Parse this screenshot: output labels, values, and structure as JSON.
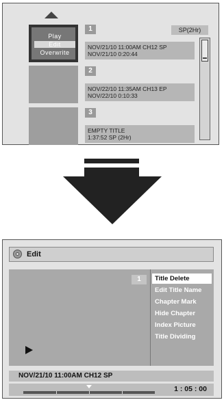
{
  "top_screen": {
    "context_menu": [
      "Play",
      "Edit",
      "Overwrite"
    ],
    "selected_menu_index": 1,
    "titles": [
      {
        "number": "1",
        "line1": "NOV/21/10  11:00AM CH12  SP",
        "line2": "NOV/21/10    0:20:44"
      },
      {
        "number": "2",
        "line1": "NOV/22/10  11:35AM CH13  EP",
        "line2": "NOV/22/10    0:10:33"
      },
      {
        "number": "3",
        "line1": "EMPTY TITLE",
        "line2": "1:37:52  SP (2Hr)"
      }
    ],
    "quality": "SP(2Hr)",
    "icons": [
      "up-arrow-icon",
      "scrollbar"
    ]
  },
  "edit_screen": {
    "header": "Edit",
    "header_icon": "disc-icon",
    "title_number": "1",
    "menu": [
      "Title Delete",
      "Edit Title Name",
      "Chapter Mark",
      "Hide Chapter",
      "Index Picture",
      "Title Dividing"
    ],
    "active_menu_index": 0,
    "info": "NOV/21/10 11:00AM CH12 SP",
    "time": "1 : 05 : 00",
    "progress_fraction": 0.5,
    "play_icon": "play-icon"
  },
  "transition_icon": "down-arrow-icon"
}
